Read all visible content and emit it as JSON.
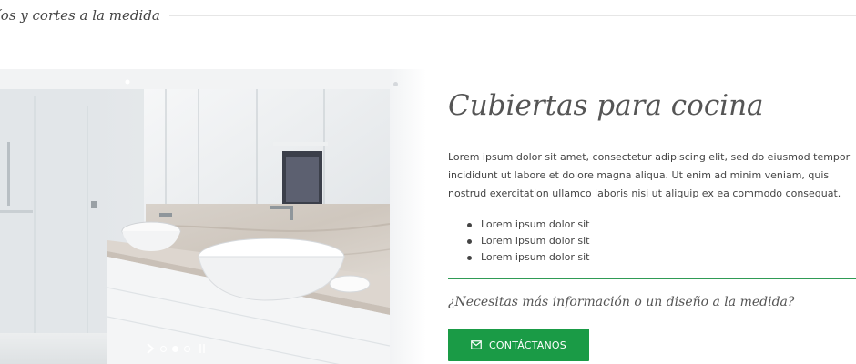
{
  "section": {
    "heading": "íos y cortes a la medida"
  },
  "product": {
    "title": "Cubiertas para cocina",
    "description": "Lorem ipsum dolor sit amet, consectetur adipiscing elit, sed do eiusmod tempor incididunt ut labore et dolore magna aliqua. Ut enim ad minim veniam, quis nostrud exercitation ullamco laboris nisi ut aliquip ex ea commodo consequat.",
    "features": [
      "Lorem ipsum dolor sit",
      "Lorem ipsum dolor sit",
      "Lorem ipsum dolor sit"
    ]
  },
  "cta": {
    "question": "¿Necesitas más información o un diseño a la medida?",
    "button_label": "CONTÁCTANOS",
    "button_icon": "envelope-icon",
    "color": "#1a9b46"
  },
  "slider": {
    "slides": 3,
    "active_index": 2
  },
  "colors": {
    "accent": "#1a9b46",
    "rule": "#2f9b55"
  }
}
